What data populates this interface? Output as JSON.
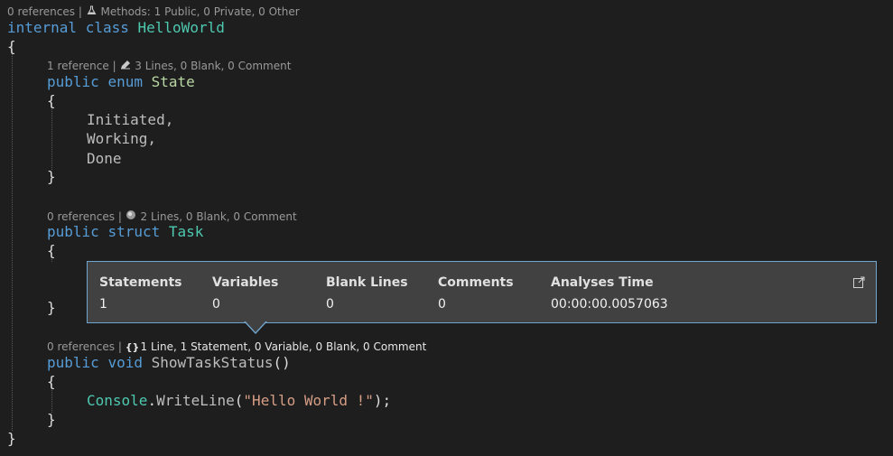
{
  "lens_class": {
    "references": "0 references",
    "sep": "|",
    "icon": "flask-icon",
    "info": "Methods: 1 Public, 0 Private, 0 Other"
  },
  "lens_enum": {
    "references": "1 reference",
    "sep": "|",
    "icon": "pencil-icon",
    "info": "3 Lines, 0 Blank, 0 Comment"
  },
  "lens_struct": {
    "references": "0 references",
    "sep": "|",
    "icon": "gear-ball-icon",
    "info": "2 Lines, 0 Blank, 0 Comment"
  },
  "lens_method": {
    "references": "0 references",
    "sep": "|",
    "icon": "braces-icon",
    "info": "1 Line, 1 Statement, 0 Variable, 0 Blank, 0 Comment"
  },
  "code": {
    "internal": "internal",
    "class": "class",
    "class_name": "HelloWorld",
    "open_brace": "{",
    "close_brace": "}",
    "public": "public",
    "enum": "enum",
    "enum_name": "State",
    "member1": "Initiated,",
    "member2": "Working,",
    "member3": "Done",
    "struct": "struct",
    "struct_name": "Task",
    "void": "void",
    "method_name": "ShowTaskStatus",
    "parens": "()",
    "console": "Console",
    "dot": ".",
    "writeline": "WriteLine",
    "paren_open": "(",
    "string": "\"Hello World !\"",
    "paren_close": ");"
  },
  "popup": {
    "columns": [
      {
        "header": "Statements",
        "value": "1"
      },
      {
        "header": "Variables",
        "value": "0"
      },
      {
        "header": "Blank Lines",
        "value": "0"
      },
      {
        "header": "Comments",
        "value": "0"
      },
      {
        "header": "Analyses Time",
        "value": "00:00:00.0057063"
      }
    ],
    "popout_icon": "popout-icon"
  },
  "colors": {
    "background": "#1e1e1e",
    "keyword": "#569cd6",
    "type": "#4ec9b0",
    "enum_type": "#b8d7a3",
    "string": "#d69d85",
    "popup_bg": "#414141",
    "popup_border": "#6fa6d0"
  }
}
